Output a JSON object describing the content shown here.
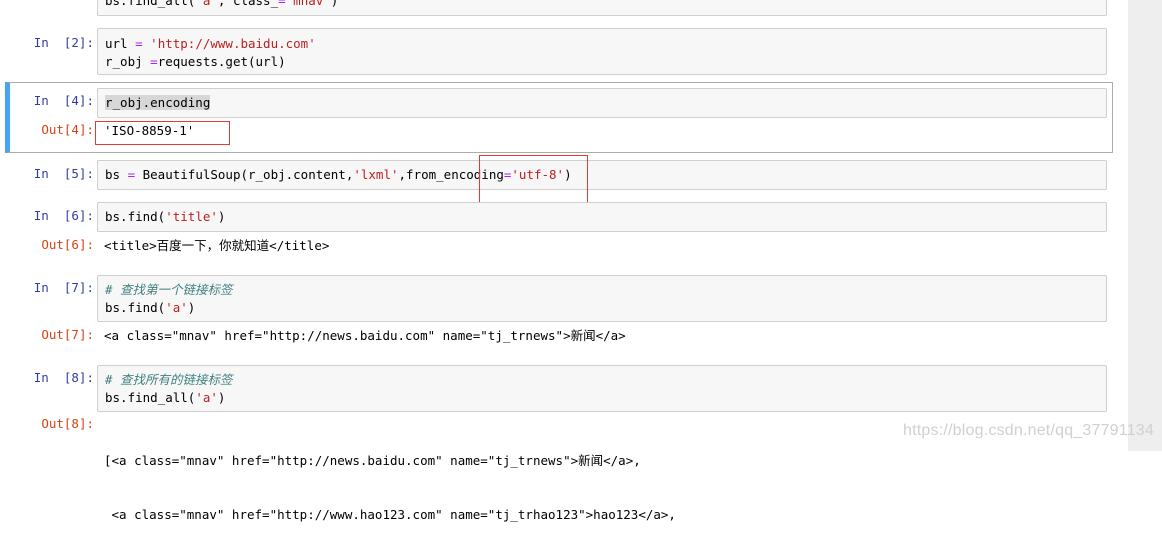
{
  "notebook": {
    "cells": [
      {
        "prompt": "",
        "type": "code",
        "lines": [
          "bs.find_all('a', class_='mnav')"
        ]
      },
      {
        "prompt": "In  [2]:",
        "type": "code",
        "lines": [
          "url = 'http://www.baidu.com'",
          "r_obj =requests.get(url)"
        ]
      },
      {
        "prompt": "In  [4]:",
        "type": "code",
        "lines": [
          "r_obj.encoding"
        ],
        "out_prompt": "Out[4]:",
        "output": "'ISO-8859-1'"
      },
      {
        "prompt": "In  [5]:",
        "type": "code",
        "lines": [
          "bs = BeautifulSoup(r_obj.content,'lxml',from_encoding='utf-8')"
        ]
      },
      {
        "prompt": "In  [6]:",
        "type": "code",
        "lines": [
          "bs.find('title')"
        ],
        "out_prompt": "Out[6]:",
        "output": "<title>百度一下，你就知道</title>"
      },
      {
        "prompt": "In  [7]:",
        "type": "code",
        "lines": [
          "# 查找第一个链接标签",
          "bs.find('a')"
        ],
        "out_prompt": "Out[7]:",
        "output": "<a class=\"mnav\" href=\"http://news.baidu.com\" name=\"tj_trnews\">新闻</a>"
      },
      {
        "prompt": "In  [8]:",
        "type": "code",
        "lines": [
          "# 查找所有的链接标签",
          "bs.find_all('a')"
        ],
        "out_prompt": "Out[8]:",
        "output_lines": [
          "[<a class=\"mnav\" href=\"http://news.baidu.com\" name=\"tj_trnews\">新闻</a>,",
          " <a class=\"mnav\" href=\"http://www.hao123.com\" name=\"tj_trhao123\">hao123</a>,"
        ]
      }
    ]
  },
  "watermark": "https://blog.csdn.net/qq_37791134",
  "colors": {
    "in_prompt": "#303f9f",
    "out_prompt": "#d84315",
    "string": "#ba2121",
    "comment": "#408080",
    "selection": "#42a5f5",
    "highlight_box": "#e53935"
  }
}
